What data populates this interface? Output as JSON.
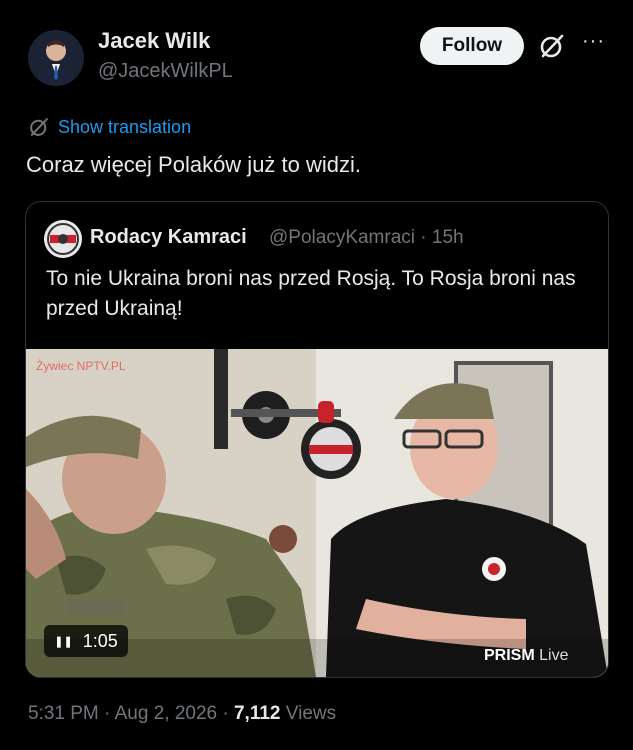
{
  "author": {
    "name": "Jacek Wilk",
    "handle": "@JacekWilkPL",
    "avatar_icon": "profile-photo-icon"
  },
  "actions": {
    "follow_label": "Follow",
    "grok_icon": "grok-icon",
    "more_icon": "more-icon",
    "more_glyph": "···"
  },
  "translation": {
    "label": "Show translation",
    "icon": "grok-icon"
  },
  "tweet": {
    "text": "Coraz więcej Polaków już to widzi."
  },
  "quoted": {
    "name": "Rodacy Kamraci",
    "handle": "@PolacyKamraci",
    "separator": "·",
    "time": "15h",
    "text": "To nie Ukraina broni nas przed Rosją. To Rosja broni nas przed Ukrainą!",
    "media": {
      "watermark": "Żywiec NPTV.PL",
      "duration": "1:05",
      "pause_glyph": "❚❚",
      "brand": "PRISM",
      "brand_suffix": "Live"
    }
  },
  "footer": {
    "time": "5:31 PM",
    "date": "Aug 2, 2026",
    "sep": "·",
    "views_count": "7,112",
    "views_label": "Views"
  },
  "colors": {
    "background": "#000000",
    "link": "#1d9bf0",
    "muted": "#71767b",
    "text": "#e7e9ea"
  }
}
